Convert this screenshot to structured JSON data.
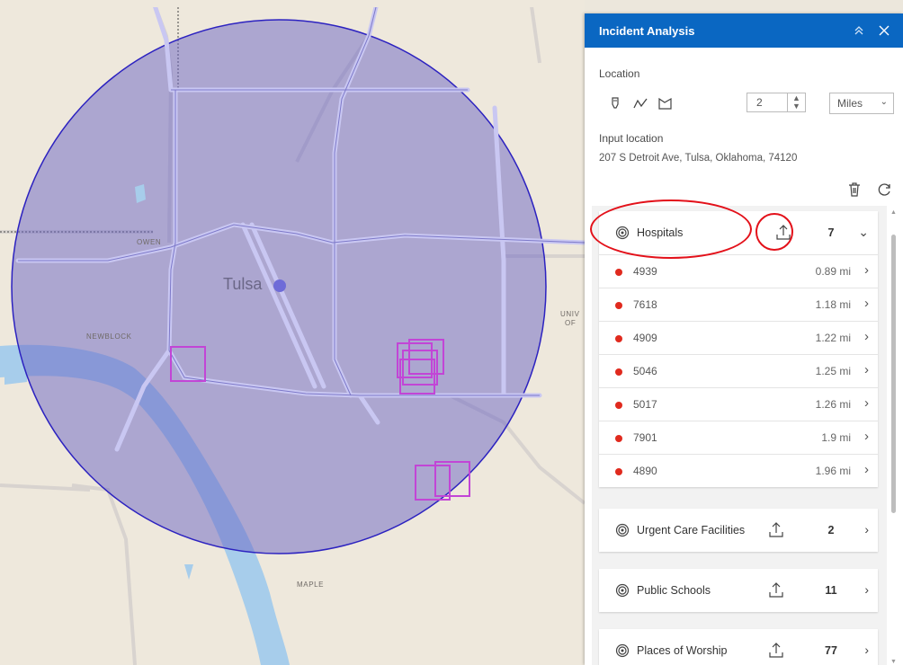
{
  "map": {
    "city_label": "Tulsa",
    "labels": [
      "OWEN",
      "NEWBLOCK",
      "MAPLE",
      "UNIV",
      "OF"
    ],
    "buffer_color": "#6a64c4",
    "marker_color": "#c245d6"
  },
  "panel": {
    "title": "Incident Analysis",
    "location_label": "Location",
    "tools": [
      "point-draw-icon",
      "polyline-draw-icon",
      "polygon-draw-icon"
    ],
    "distance_value": "2",
    "distance_units": "Miles",
    "input_location_label": "Input location",
    "input_location_value": "207 S Detroit Ave, Tulsa, Oklahoma, 74120"
  },
  "layers": [
    {
      "name": "Hospitals",
      "count": "7",
      "expanded": true,
      "rows": [
        {
          "name": "4939",
          "dist": "0.89 mi"
        },
        {
          "name": "7618",
          "dist": "1.18 mi"
        },
        {
          "name": "4909",
          "dist": "1.22 mi"
        },
        {
          "name": "5046",
          "dist": "1.25 mi"
        },
        {
          "name": "5017",
          "dist": "1.26 mi"
        },
        {
          "name": "7901",
          "dist": "1.9 mi"
        },
        {
          "name": "4890",
          "dist": "1.96 mi"
        }
      ]
    },
    {
      "name": "Urgent Care Facilities",
      "count": "2",
      "expanded": false
    },
    {
      "name": "Public Schools",
      "count": "11",
      "expanded": false
    },
    {
      "name": "Places of Worship",
      "count": "77",
      "expanded": false
    }
  ],
  "colors": {
    "header": "#0a67c2",
    "result_dot": "#e02a1e",
    "callout": "#e3111a"
  }
}
